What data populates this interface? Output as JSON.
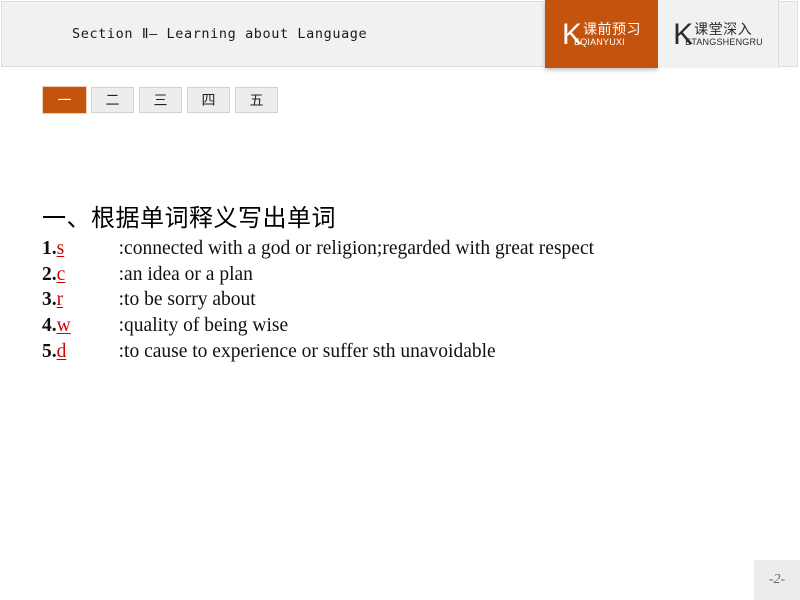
{
  "header": {
    "title": "Section Ⅱ— Learning about Language",
    "module_tabs": [
      {
        "k": "K",
        "cn": "课前预习",
        "pinyin": "EQIANYUXI",
        "active": true
      },
      {
        "k": "K",
        "cn": "课堂深入",
        "pinyin": "ETANGSHENGRU",
        "active": false
      }
    ]
  },
  "num_tabs": [
    {
      "label": "一",
      "active": true
    },
    {
      "label": "二",
      "active": false
    },
    {
      "label": "三",
      "active": false
    },
    {
      "label": "四",
      "active": false
    },
    {
      "label": "五",
      "active": false
    }
  ],
  "content": {
    "heading": "一、根据单词释义写出单词",
    "items": [
      {
        "num": "1.",
        "hint": "s",
        "definition": ":connected with a god or religion;regarded with great respect"
      },
      {
        "num": "2.",
        "hint": "c",
        "definition": ":an idea or a plan"
      },
      {
        "num": "3.",
        "hint": "r",
        "definition": ":to be sorry about"
      },
      {
        "num": "4.",
        "hint": "w",
        "definition": ":quality of being wise"
      },
      {
        "num": "5.",
        "hint": "d",
        "definition": ":to cause to experience or suffer sth unavoidable"
      }
    ]
  },
  "footer": {
    "page_number": "-2-"
  },
  "colors": {
    "accent": "#c4540d",
    "hint_red": "#cc0000",
    "header_bg": "#f1f1f1",
    "tab_inactive_bg": "#ededed"
  }
}
